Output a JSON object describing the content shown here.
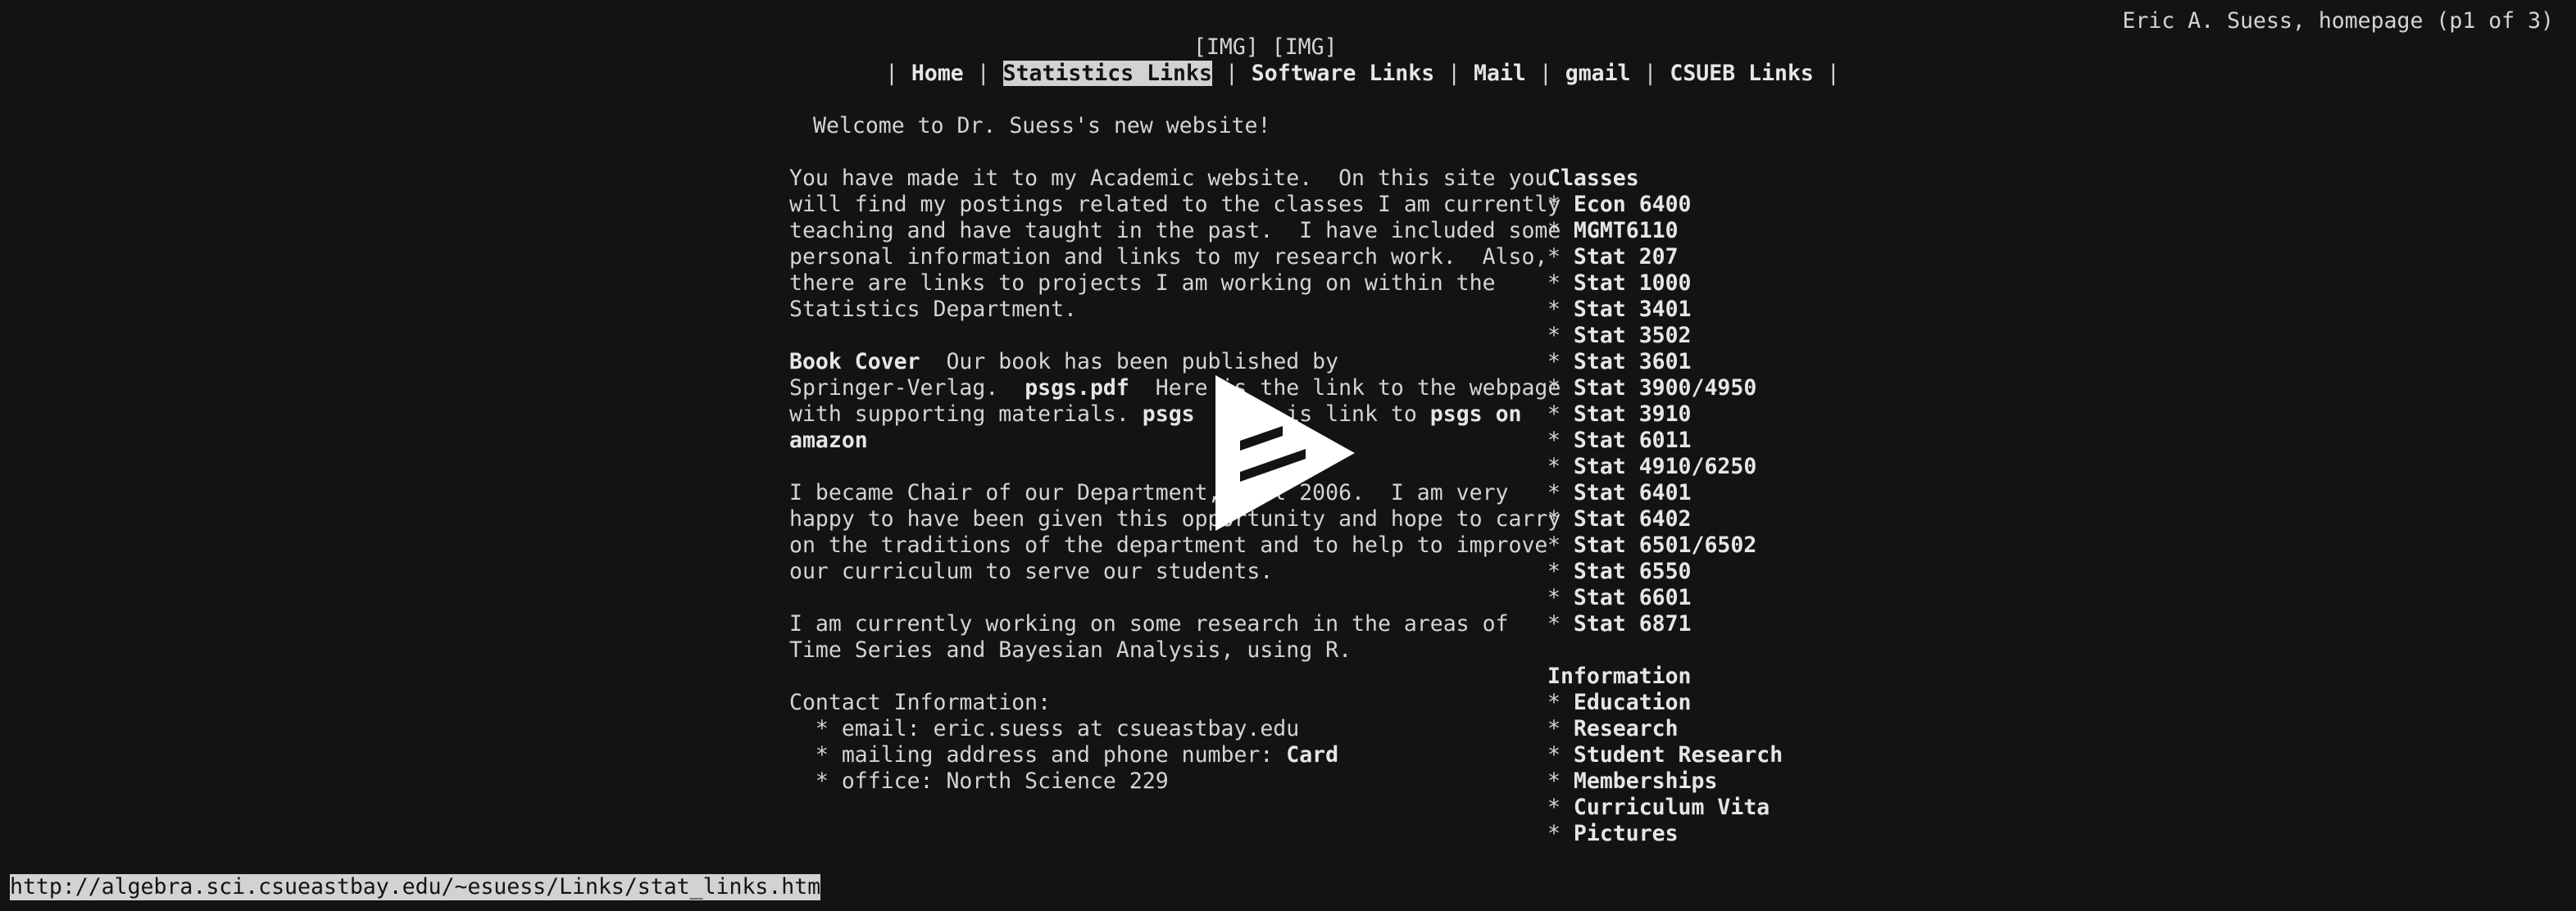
{
  "header": {
    "page_info": "Eric A. Suess, homepage (p1 of 3)",
    "images": [
      "[IMG]",
      "[IMG]"
    ]
  },
  "nav": {
    "items": [
      "Home",
      "Statistics Links",
      "Software Links",
      "Mail",
      "gmail",
      "CSUEB Links"
    ],
    "selected": "Statistics Links"
  },
  "main": {
    "welcome": "Welcome to Dr. Suess's new website!",
    "intro": [
      "You have made it to my Academic website.  On this site you",
      "will find my postings related to the classes I am currently",
      "teaching and have taught in the past.  I have included some",
      "personal information and links to my research work.  Also,",
      "there are links to projects I am working on within the",
      "Statistics Department."
    ],
    "book": {
      "cover_link": "Book Cover",
      "text1": "  Our book has been published by",
      "text2": "Springer-Verlag.  ",
      "pdf_link": "psgs.pdf",
      "text3": "  Here is the link to the webpage",
      "text4": "with supporting materials. ",
      "psgs_link": "psgs",
      "text5": "  Here is link to ",
      "amazon_link_1": "psgs on",
      "amazon_link_2": "amazon"
    },
    "chair": [
      "I became Chair of our Department, Fall 2006.  I am very",
      "happy to have been given this opportunity and hope to carry",
      "on the traditions of the department and to help to improve",
      "our curriculum to serve our students."
    ],
    "research": [
      "I am currently working on some research in the areas of",
      "Time Series and Bayesian Analysis, using R."
    ],
    "contact": {
      "heading": "Contact Information:",
      "email": "  * email: eric.suess at csueastbay.edu",
      "mailing_prefix": "  * mailing address and phone number: ",
      "card_link": "Card",
      "office": "  * office: North Science 229"
    }
  },
  "sidebar": {
    "classes_heading": "Classes",
    "classes": [
      "Econ 6400",
      "MGMT6110",
      "Stat 207",
      "Stat 1000",
      "Stat 3401",
      "Stat 3502",
      "Stat 3601",
      "Stat 3900/4950",
      "Stat 3910",
      "Stat 6011",
      "Stat 4910/6250",
      "Stat 6401",
      "Stat 6402",
      "Stat 6501/6502",
      "Stat 6550",
      "Stat 6601",
      "Stat 6871"
    ],
    "info_heading": "Information",
    "info": [
      "Education",
      "Research",
      "Student Research",
      "Memberships",
      "Curriculum Vita",
      "Pictures"
    ],
    "bullet": "* "
  },
  "status_bar": {
    "url": "http://algebra.sci.csueastbay.edu/~esuess/Links/stat_links.htm"
  },
  "overlay": {
    "icon": "play-icon"
  }
}
